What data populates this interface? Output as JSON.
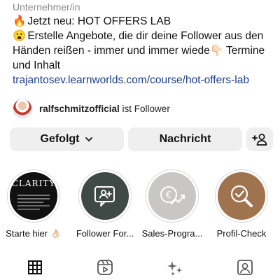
{
  "bio": {
    "category": "Unternehmer/in",
    "line1_emoji": "🔥",
    "line1": "Jetzt neu: HOT OFFERS LAB",
    "line2_emoji": "😮",
    "line2": "Erstelle Angebote, die dir deine Follower aus den Händen reißen - immer und immer wiede👇🏻 Termine und Inhalt",
    "link": "trajantosev.learnworlds.com/course/hot-offers-lab"
  },
  "followed_by": {
    "username": "ralfschmitzofficial",
    "suffix": "ist Follower"
  },
  "buttons": {
    "follow_label": "Gefolgt",
    "follow_chevron": "⌄",
    "message_label": "Nachricht",
    "add_person_icon": "add-person-icon"
  },
  "highlights": [
    {
      "label": "Starte hier 👌🏻",
      "cover_text": "CLARITY",
      "cover_color": "#111111"
    },
    {
      "label": "Follower For...",
      "icon": "add-user-chat-icon",
      "cover_color": "#3f4a47"
    },
    {
      "label": "Sales-Progra...",
      "icon": "euro-growth-icon",
      "cover_color": "#c9c7c4"
    },
    {
      "label": "Profil-Check",
      "icon": "magnifier-check-icon",
      "cover_color": "#a0734f"
    }
  ],
  "tabs": [
    {
      "name": "grid-icon",
      "active": true
    },
    {
      "name": "reels-icon",
      "active": false
    },
    {
      "name": "sparkles-icon",
      "active": false
    },
    {
      "name": "tagged-icon",
      "active": false
    }
  ]
}
